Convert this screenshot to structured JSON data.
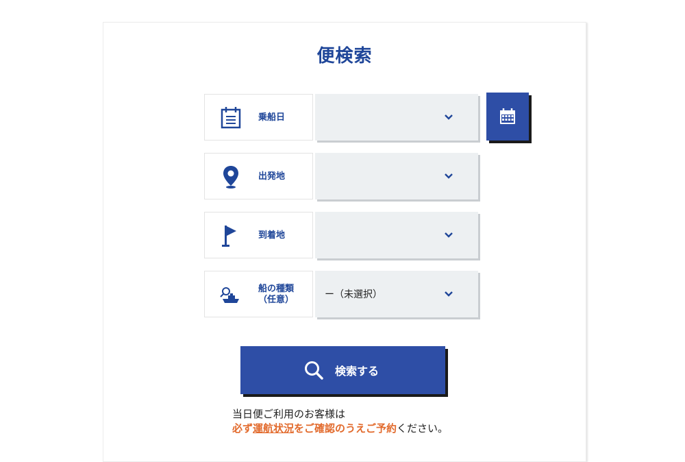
{
  "page": {
    "title": "便検索"
  },
  "form": {
    "rows": [
      {
        "label": "乗船日",
        "value": "",
        "icon": "calendar-list-icon"
      },
      {
        "label": "出発地",
        "value": "",
        "icon": "map-pin-icon"
      },
      {
        "label": "到着地",
        "value": "",
        "icon": "flag-icon"
      },
      {
        "label_line1": "船の種類",
        "label_line2": "（任意）",
        "value": "ー（未選択）",
        "icon": "ship-search-icon"
      }
    ],
    "calendar_button_icon": "calendar-icon",
    "search_button_label": "検索する",
    "search_button_icon": "search-icon"
  },
  "notice": {
    "line1": "当日便ご利用のお客様は",
    "prefix": "必ず",
    "link": "運航状況",
    "suffix": "をご確認のうえご予約",
    "tail": "ください。"
  },
  "colors": {
    "brand_blue": "#2e4ea6",
    "label_blue": "#1f4699",
    "accent_orange": "#e26a2c",
    "select_bg": "#edf0f2"
  }
}
